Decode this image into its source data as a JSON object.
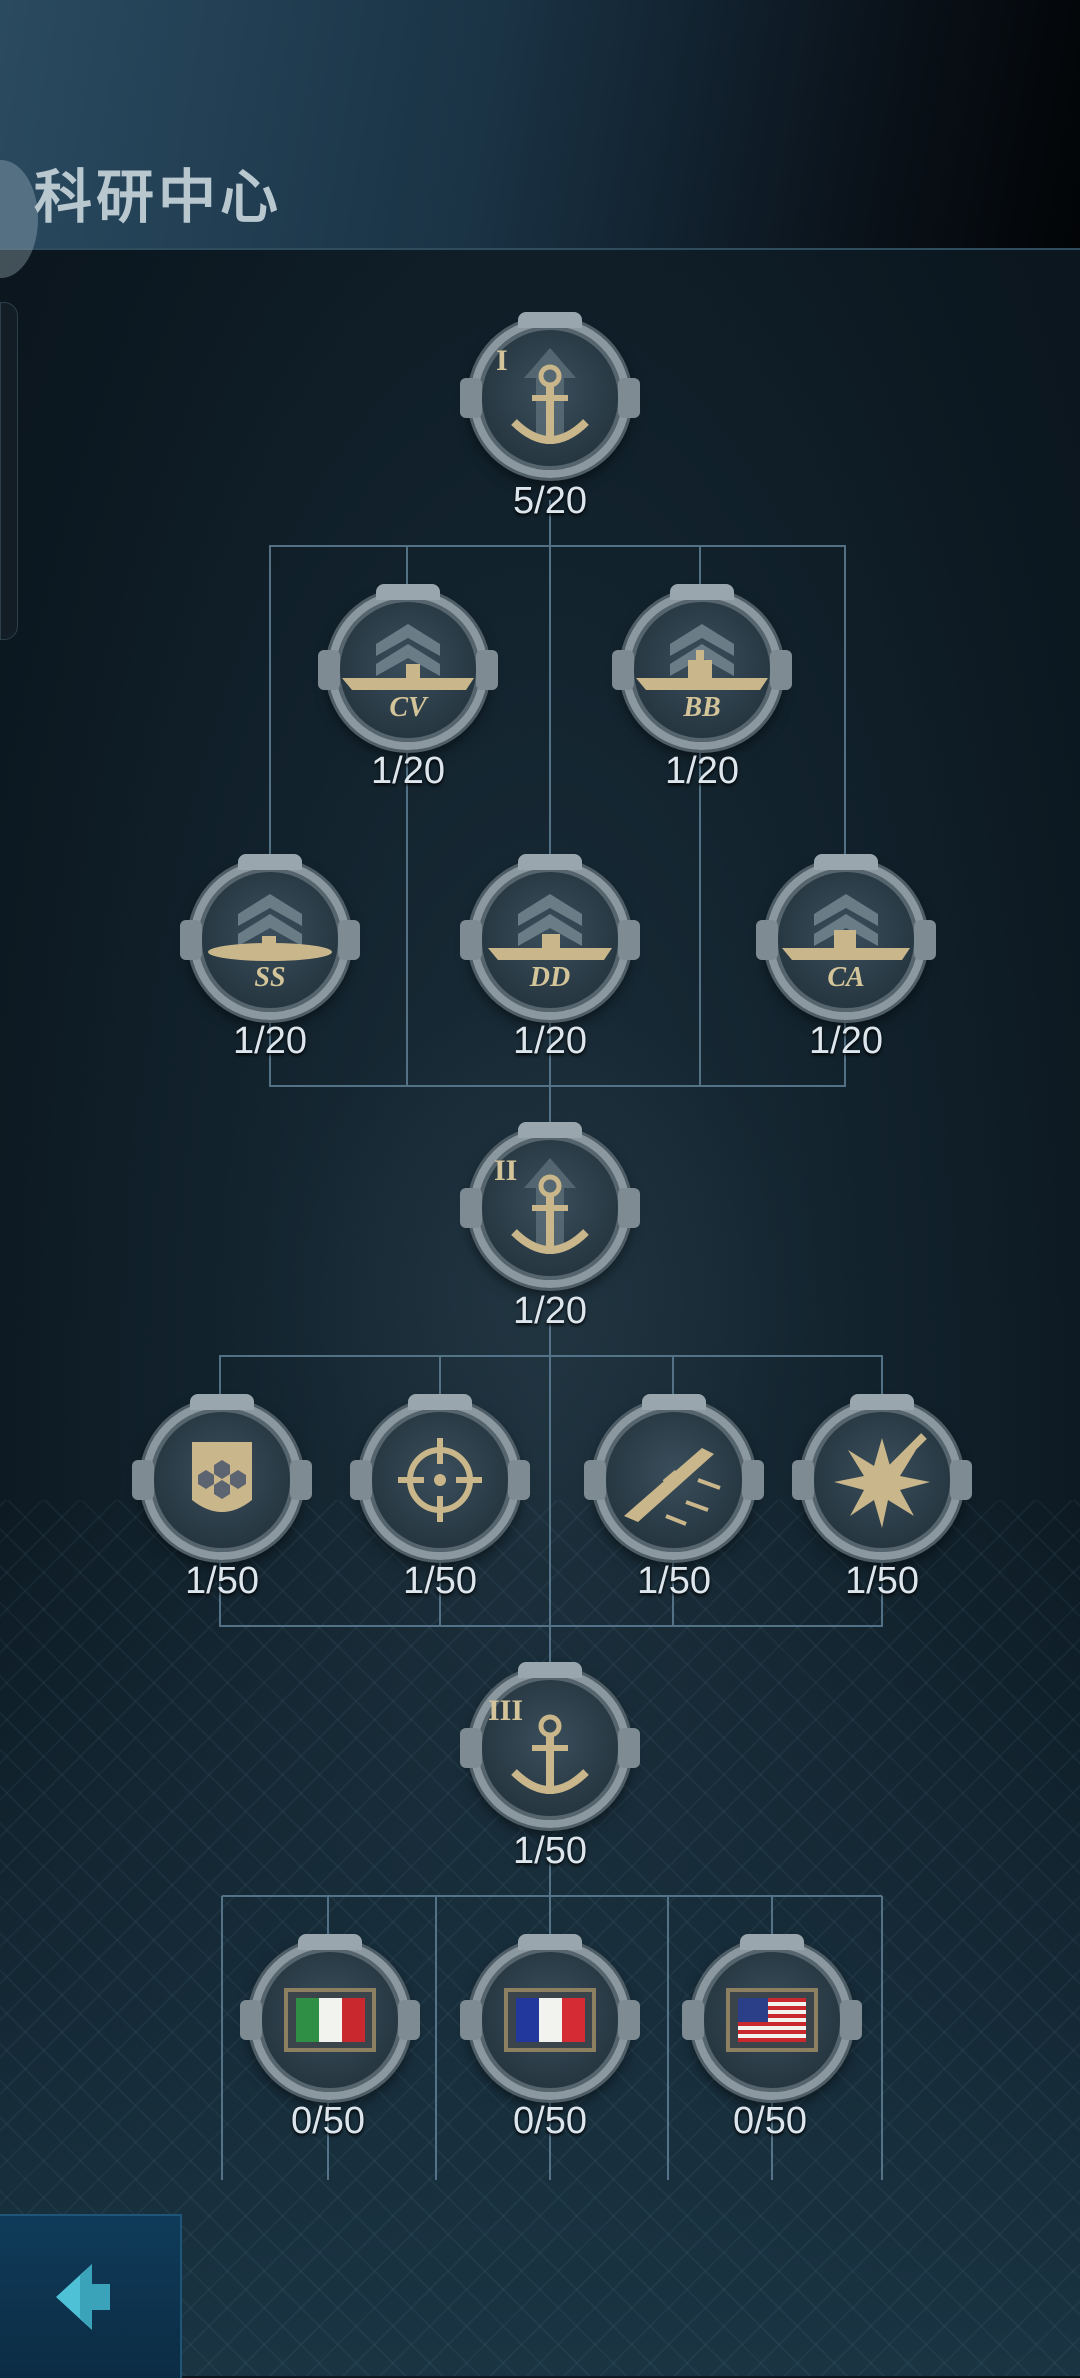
{
  "header": {
    "title": "科研中心"
  },
  "tree": {
    "root1": {
      "numeral": "I",
      "icon": "anchor-icon",
      "progress": "5/20"
    },
    "ships_row1": [
      {
        "code": "CV",
        "icon": "aircraft-carrier-icon",
        "progress": "1/20"
      },
      {
        "code": "BB",
        "icon": "battleship-icon",
        "progress": "1/20"
      }
    ],
    "ships_row2": [
      {
        "code": "SS",
        "icon": "submarine-icon",
        "progress": "1/20"
      },
      {
        "code": "DD",
        "icon": "destroyer-icon",
        "progress": "1/20"
      },
      {
        "code": "CA",
        "icon": "cruiser-icon",
        "progress": "1/20"
      }
    ],
    "root2": {
      "numeral": "II",
      "icon": "anchor-icon",
      "progress": "1/20"
    },
    "abilities": [
      {
        "icon": "armor-shield-icon",
        "progress": "1/50"
      },
      {
        "icon": "crosshair-icon",
        "progress": "1/50"
      },
      {
        "icon": "torpedo-ship-icon",
        "progress": "1/50"
      },
      {
        "icon": "explosion-icon",
        "progress": "1/50"
      }
    ],
    "root3": {
      "numeral": "III",
      "icon": "anchor-icon",
      "progress": "1/50"
    },
    "nations": [
      {
        "icon": "italy-flag-icon",
        "progress": "0/50"
      },
      {
        "icon": "france-flag-icon",
        "progress": "0/50"
      },
      {
        "icon": "usa-flag-icon",
        "progress": "0/50"
      }
    ]
  },
  "footer": {
    "back_icon": "back-arrow-icon"
  },
  "colors": {
    "gold": "#c9b68a",
    "line": "#5f7f95",
    "text": "#dde6ec"
  }
}
